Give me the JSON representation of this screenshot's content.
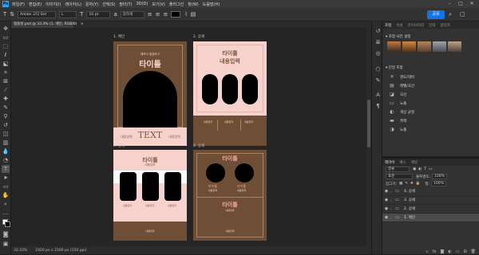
{
  "menubar": {
    "logo": "Ps",
    "items": [
      "파일(F)",
      "편집(E)",
      "이미지(I)",
      "레이어(L)",
      "문자(Y)",
      "선택(S)",
      "필터(T)",
      "3D(D)",
      "보기(V)",
      "플러그인",
      "창(W)",
      "도움말(H)"
    ],
    "window_controls": [
      "–",
      "□",
      "✕"
    ]
  },
  "options_bar": {
    "font_family": "Adobe 고딕 Std",
    "font_style": "L",
    "font_size": "10 pt",
    "antialias": "강하게",
    "share_label": "공유"
  },
  "document_tab": {
    "label": "템플릿.psd @ 33.3% (1. 메인, RGB/8)",
    "close": "×"
  },
  "artboards": [
    {
      "label": "1. 메인",
      "small_title": "예쁘고 깔끔하고",
      "title": "타이틀",
      "left_text": "내용입력",
      "center_text": "TEXT",
      "right_text": "내용입력"
    },
    {
      "label": "2. 상세",
      "title": "타이틀",
      "subtitle": "내용입력",
      "columns": [
        "내용입력",
        "내용입력",
        "내용입력"
      ]
    },
    {
      "label": "3. 상세",
      "title": "타이틀",
      "subtitle": "내용입력",
      "captions": [
        "내용입력",
        "내용입력",
        "내용입력"
      ],
      "footer": "내용입력"
    },
    {
      "label": "4. 상세",
      "title": "타이틀",
      "circle_caption_1": "타이틀",
      "circle_caption_2": "타이틀",
      "circle_sub_1": "내용입력",
      "circle_sub_2": "내용입력",
      "title_2": "타이틀",
      "sub_2": "내용입력",
      "footer": "내용입력"
    }
  ],
  "status_bar": {
    "zoom": "33.33%",
    "doc_size": "1920 px x 2160 px (150 ppi)"
  },
  "panels": {
    "top_tabs": [
      "조정",
      "속성",
      "라이브러리",
      "단락",
      "글리프"
    ],
    "adjust_presets_heading": "조정 사전 설정",
    "single_adjust_heading": "단일 조정",
    "adjustments": [
      {
        "icon": "☀",
        "label": "명도/대비"
      },
      {
        "icon": "▤",
        "label": "레벨/곡선"
      },
      {
        "icon": "◪",
        "label": "곡선"
      },
      {
        "icon": "▭",
        "label": "노출"
      },
      {
        "icon": "◐",
        "label": "색상 균형"
      },
      {
        "icon": "▬",
        "label": "흑백"
      },
      {
        "icon": "◑",
        "label": "노출"
      }
    ],
    "layer_tabs": [
      "레이어",
      "패스",
      "채널"
    ],
    "layer_search": "종류",
    "blend_mode": "표준",
    "opacity_label": "불투명도:",
    "opacity_value": "100%",
    "lock_label": "잠그기:",
    "fill_label": "칠:",
    "fill_value": "100%",
    "layers": [
      {
        "name": "4. 상세",
        "selected": false
      },
      {
        "name": "3. 상세",
        "selected": false
      },
      {
        "name": "2. 상세",
        "selected": false
      },
      {
        "name": "1. 메인",
        "selected": true
      }
    ]
  },
  "colors": {
    "brown": "#6e4e34",
    "pink": "#f7d2cc",
    "accent_blue": "#1473e6",
    "art_title_pink": "#f3a6a0"
  }
}
